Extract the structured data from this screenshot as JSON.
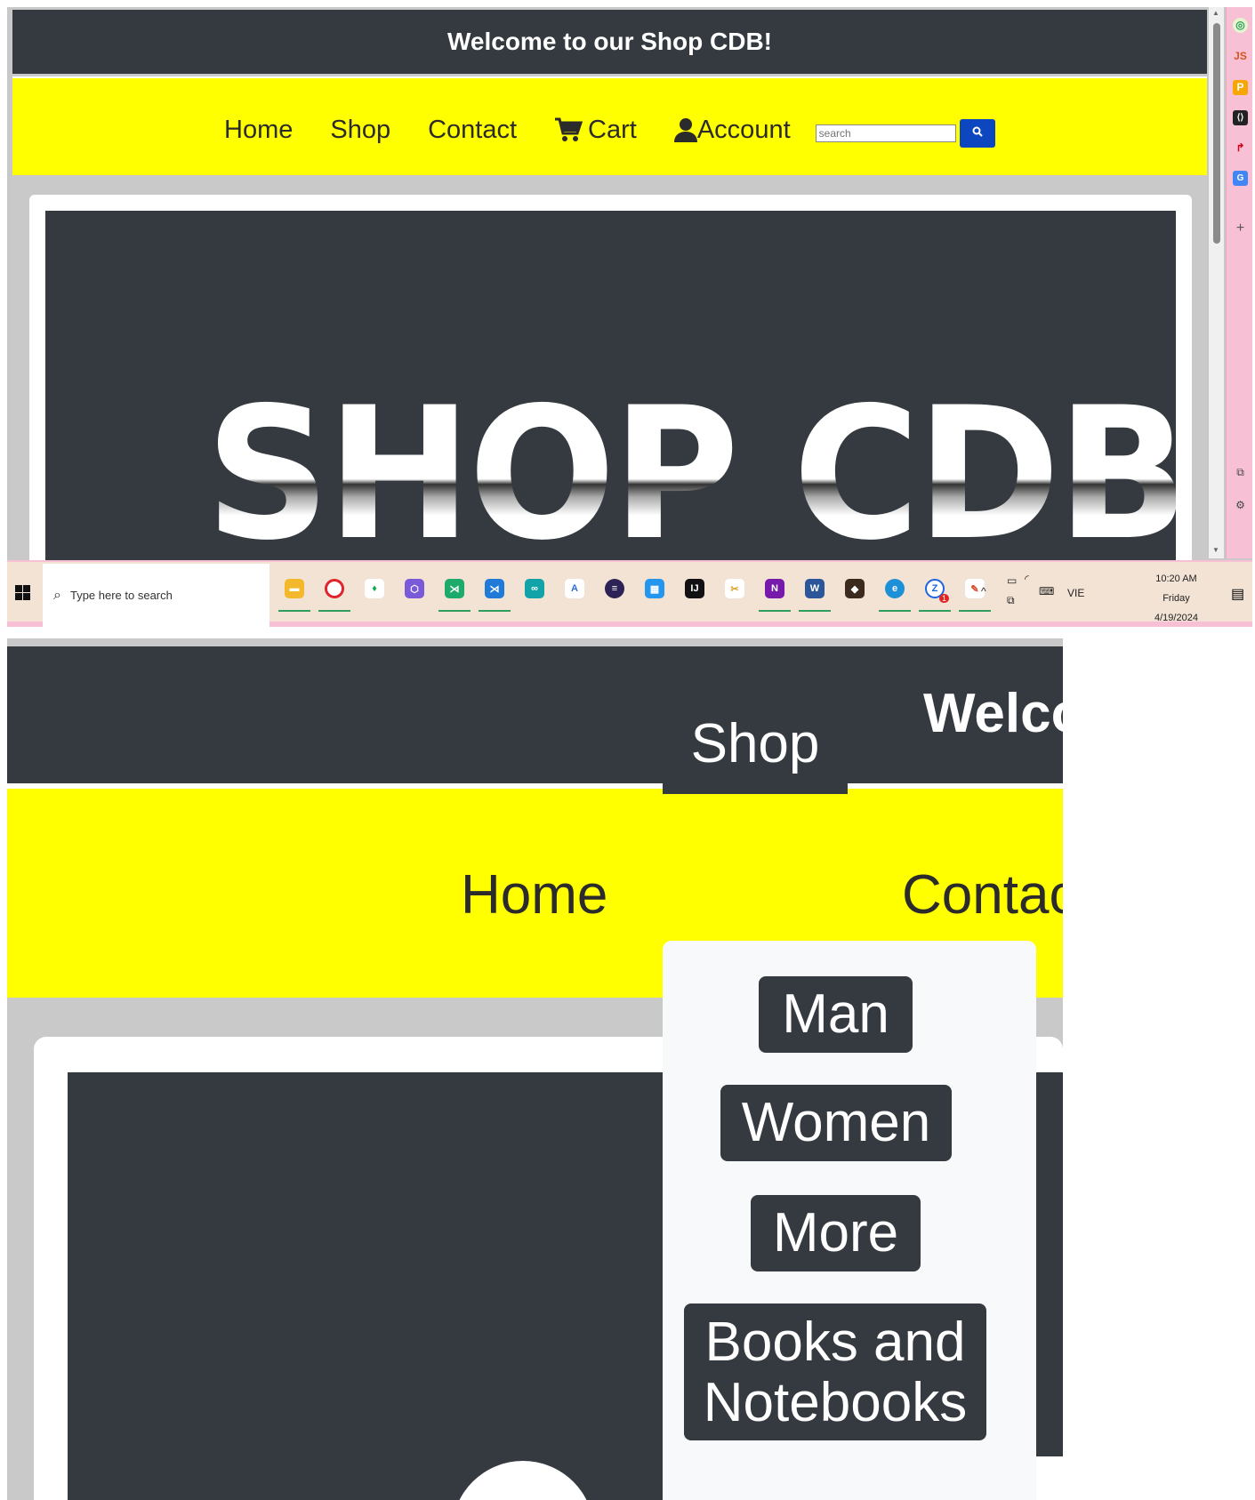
{
  "top": {
    "header_title": "Welcome to our Shop CDB!",
    "nav": {
      "home": "Home",
      "shop": "Shop",
      "contact": "Contact",
      "cart": "Cart",
      "account": "Account"
    },
    "search_placeholder": "search",
    "hero_text": "SHOP CDB",
    "taskbar": {
      "search_placeholder": "Type here to search",
      "language": "VIE",
      "time": "10:20 AM",
      "day": "Friday",
      "date": "4/19/2024",
      "badge": "1"
    }
  },
  "zoom": {
    "header_title": "Welco",
    "nav": {
      "home": "Home",
      "shop": "Shop",
      "contact": "Contac"
    },
    "dropdown": [
      "Man",
      "Women",
      "More",
      "Books and Notebooks"
    ]
  },
  "icons": {
    "cart": "cart-icon",
    "account": "user-icon",
    "search": "search-icon"
  },
  "colors": {
    "header_bg": "#343a40",
    "nav_bg": "#ffff00",
    "search_btn": "#0d47c0",
    "sidebar": "#f7c0d4"
  }
}
